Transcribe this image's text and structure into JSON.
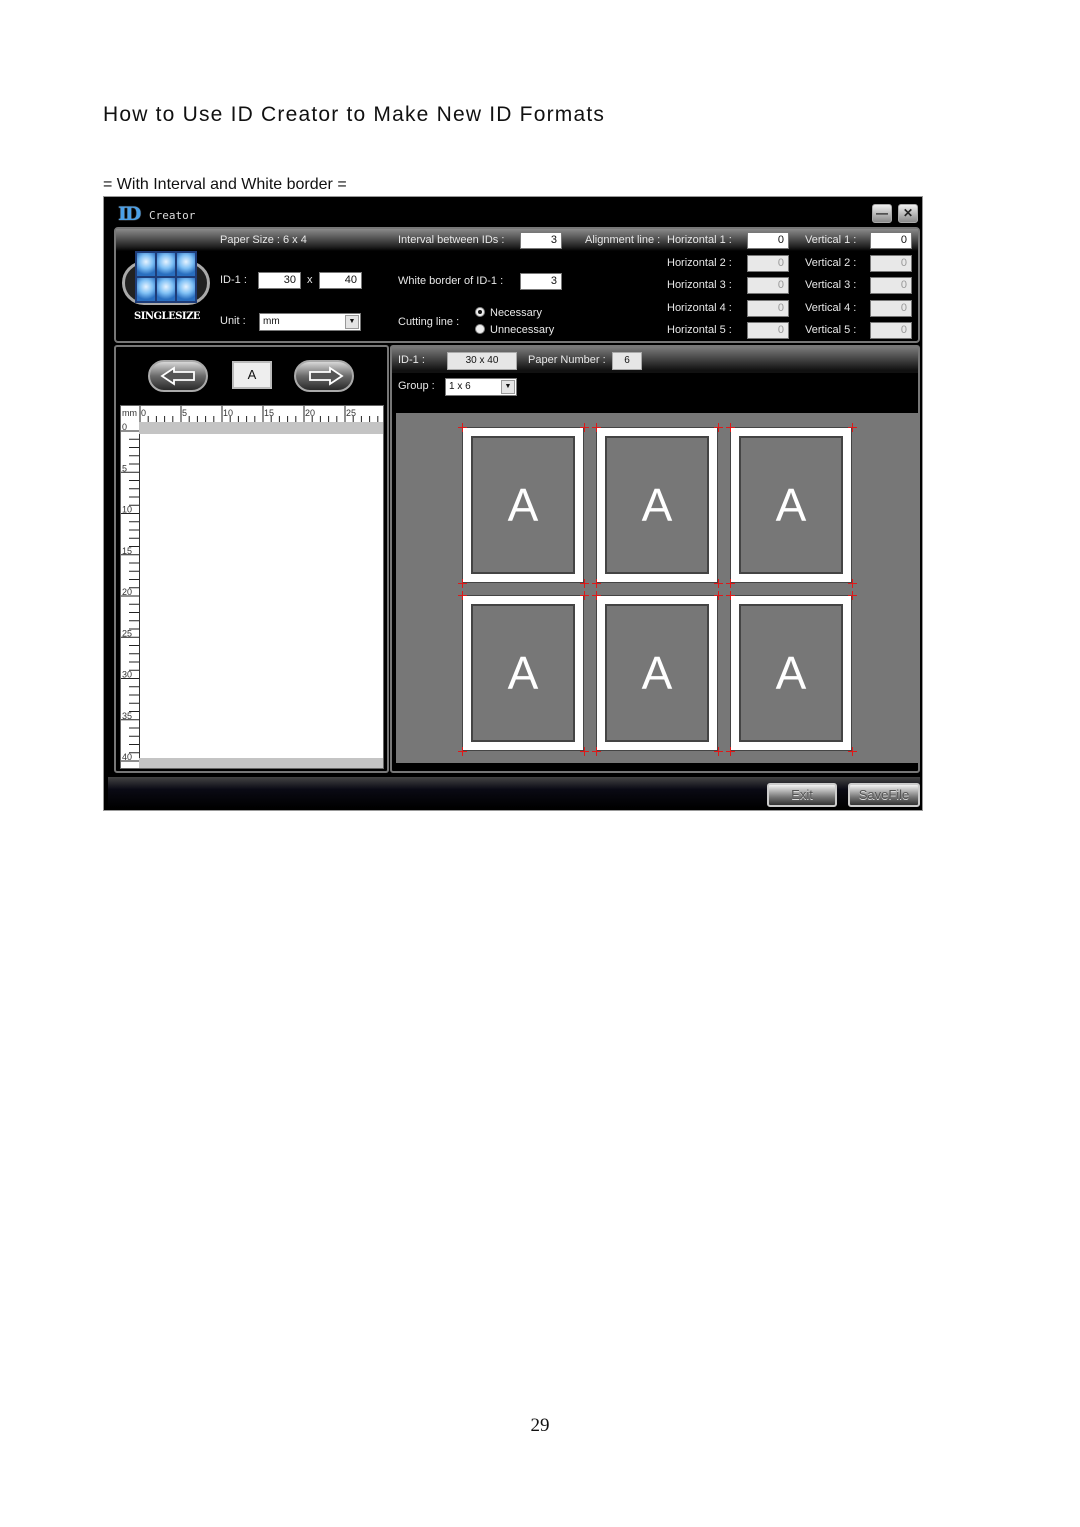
{
  "document": {
    "title": "How to Use ID Creator to Make New ID Formats",
    "subtitle": "= With Interval and White border =",
    "page_number": "29"
  },
  "window": {
    "logo_mark": "ID",
    "app_name": "Creator",
    "minimize_glyph": "—",
    "close_glyph": "✕"
  },
  "settings": {
    "logo_caption": "SINGLESIZE",
    "paper_size_label": "Paper Size : 6 x 4",
    "id1_label": "ID-1 :",
    "id1_width": "30",
    "id1_x": "x",
    "id1_height": "40",
    "unit_label": "Unit :",
    "unit_value": "mm",
    "interval_label": "Interval between IDs :",
    "interval_value": "3",
    "white_border_label": "White border of ID-1 :",
    "white_border_value": "3",
    "cutting_line_label": "Cutting line :",
    "cutting_options": [
      {
        "label": "Necessary",
        "selected": true
      },
      {
        "label": "Unnecessary",
        "selected": false
      }
    ],
    "alignment_label": "Alignment line :",
    "horizontal": [
      {
        "label": "Horizontal 1 :",
        "value": "0",
        "enabled": true
      },
      {
        "label": "Horizontal 2 :",
        "value": "0",
        "enabled": false
      },
      {
        "label": "Horizontal 3 :",
        "value": "0",
        "enabled": false
      },
      {
        "label": "Horizontal 4 :",
        "value": "0",
        "enabled": false
      },
      {
        "label": "Horizontal 5 :",
        "value": "0",
        "enabled": false
      }
    ],
    "vertical": [
      {
        "label": "Vertical 1 :",
        "value": "0",
        "enabled": true
      },
      {
        "label": "Vertical 2 :",
        "value": "0",
        "enabled": false
      },
      {
        "label": "Vertical 3 :",
        "value": "0",
        "enabled": false
      },
      {
        "label": "Vertical 4 :",
        "value": "0",
        "enabled": false
      },
      {
        "label": "Vertical 5 :",
        "value": "0",
        "enabled": false
      }
    ]
  },
  "editor": {
    "current_id": "A",
    "ruler_unit": "mm",
    "ruler_top_ticks": [
      "0",
      "5",
      "10",
      "15",
      "20",
      "25"
    ],
    "ruler_left_ticks": [
      "0",
      "5",
      "10",
      "15",
      "20",
      "25",
      "30",
      "35",
      "40"
    ]
  },
  "preview": {
    "id_label": "ID-1 :",
    "id_value": "30 x 40",
    "paper_number_label": "Paper Number :",
    "paper_number_value": "6",
    "group_label": "Group :",
    "group_value": "1 x 6",
    "cards": [
      "A",
      "A",
      "A",
      "A",
      "A",
      "A"
    ]
  },
  "footer": {
    "exit_label": "Exit",
    "save_label": "SaveFile"
  }
}
